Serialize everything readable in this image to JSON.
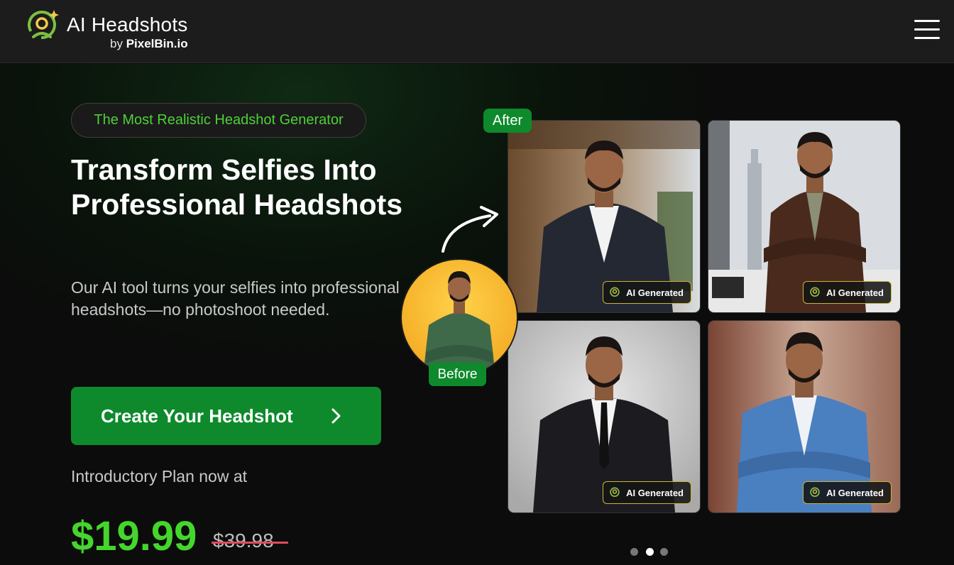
{
  "header": {
    "brand_title": "AI Headshots",
    "brand_by": "by",
    "brand_name": "PixelBin.io",
    "menu_icon": "hamburger-menu-icon"
  },
  "hero": {
    "tag": "The Most Realistic Headshot Generator",
    "headline": "Transform Selfies Into Professional Headshots",
    "description": "Our AI tool turns your selfies into professional headshots—no photoshoot needed.",
    "cta_label": "Create Your Headshot",
    "cta_icon": "chevron-right-icon",
    "intro_text": "Introductory Plan now at",
    "price_current": "$19.99",
    "price_original": "$39.98",
    "accent_color": "#44d62c",
    "button_color": "#0e8a2c",
    "strike_color": "#e04a5f"
  },
  "showcase": {
    "after_label": "After",
    "before_label": "Before",
    "badge_label": "AI Generated",
    "badge_icon": "ai-logo-icon",
    "photos": [
      {
        "name": "office-dark-suit"
      },
      {
        "name": "city-brown-blazer"
      },
      {
        "name": "studio-black-suit"
      },
      {
        "name": "street-blue-blazer"
      }
    ]
  },
  "carousel": {
    "total_slides": 3,
    "active_slide": 2
  }
}
